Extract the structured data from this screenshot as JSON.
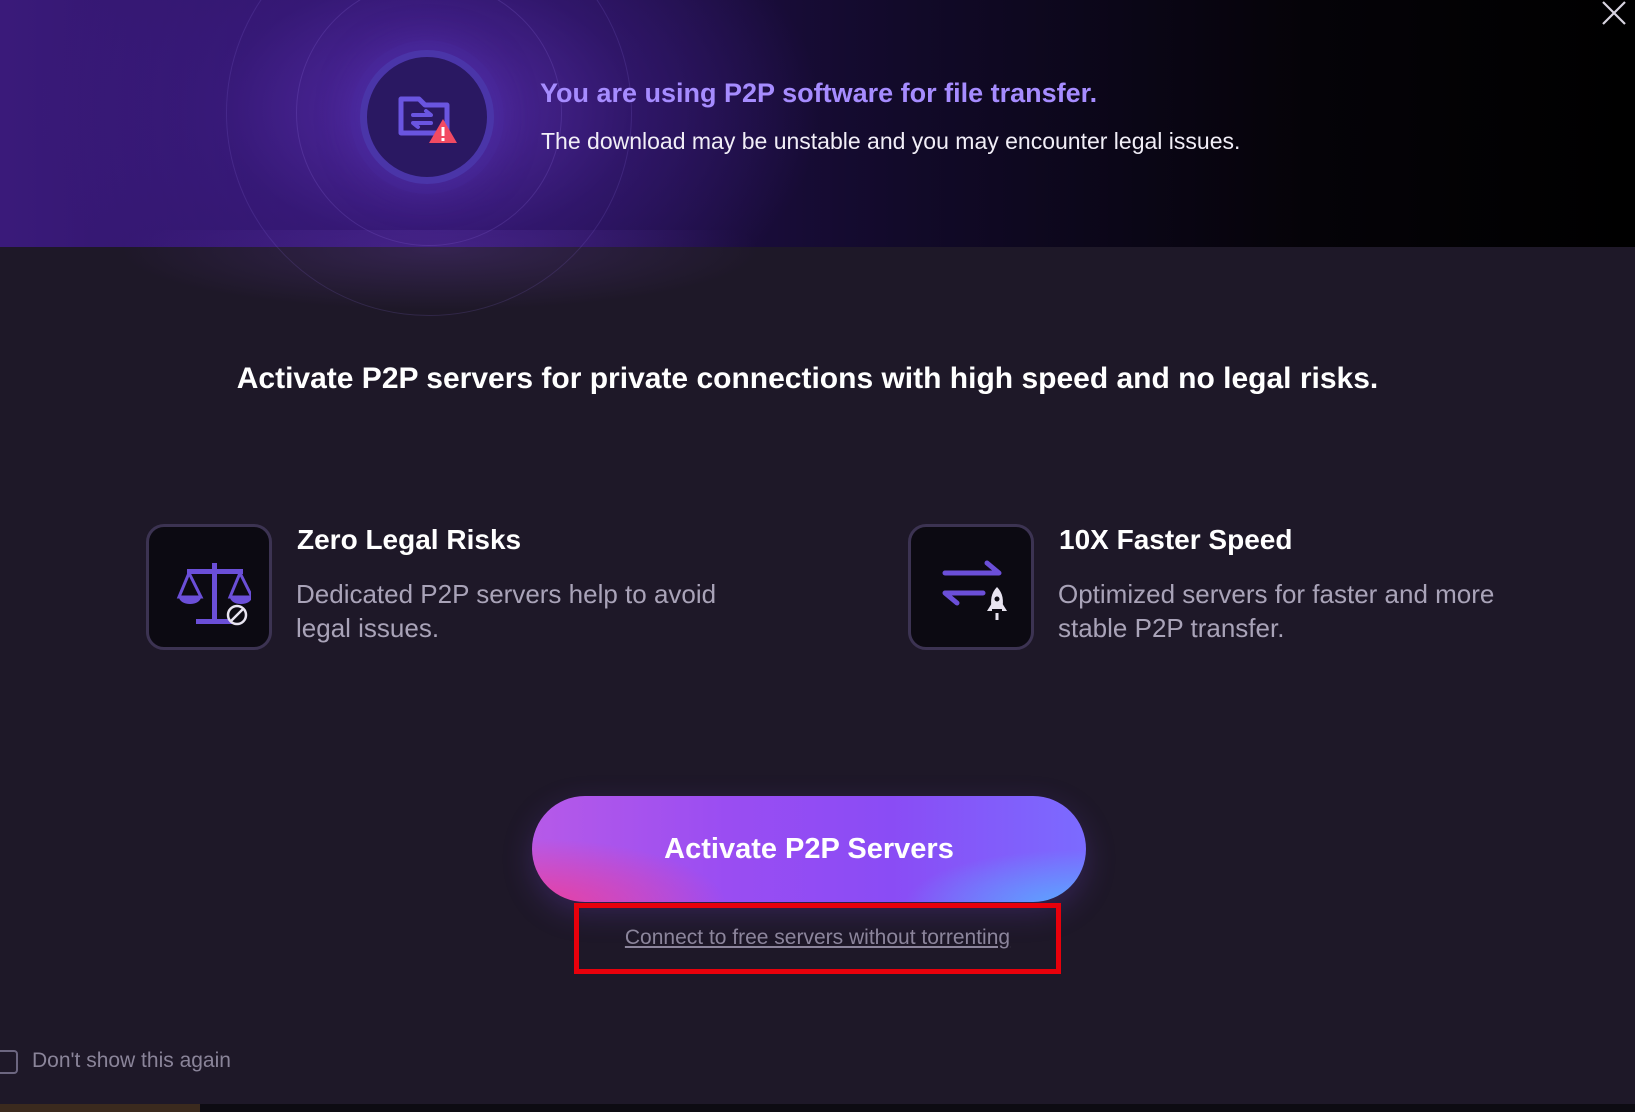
{
  "banner": {
    "title": "You are using P2P software for file transfer.",
    "subtitle": "The download may be unstable and you may encounter legal issues.",
    "icon": "folder-transfer-warning-icon"
  },
  "close": {
    "icon": "close-icon"
  },
  "headline": "Activate P2P servers for private connections with high speed and no legal risks.",
  "features": [
    {
      "icon": "scale-blocked-icon",
      "title": "Zero Legal Risks",
      "description": "Dedicated P2P servers help to avoid legal issues."
    },
    {
      "icon": "transfer-rocket-icon",
      "title": "10X Faster Speed",
      "description": "Optimized servers for faster and more stable P2P transfer."
    }
  ],
  "primary_button": {
    "label": "Activate P2P Servers"
  },
  "secondary_link": {
    "label": "Connect to free servers without torrenting"
  },
  "dont_show": {
    "label": "Don't show this again",
    "checked": false
  },
  "colors": {
    "accent_title": "#a68cff",
    "highlight_border": "#e8000b",
    "button_gradient_start": "#b65ae8",
    "button_gradient_end": "#7b6bff"
  }
}
